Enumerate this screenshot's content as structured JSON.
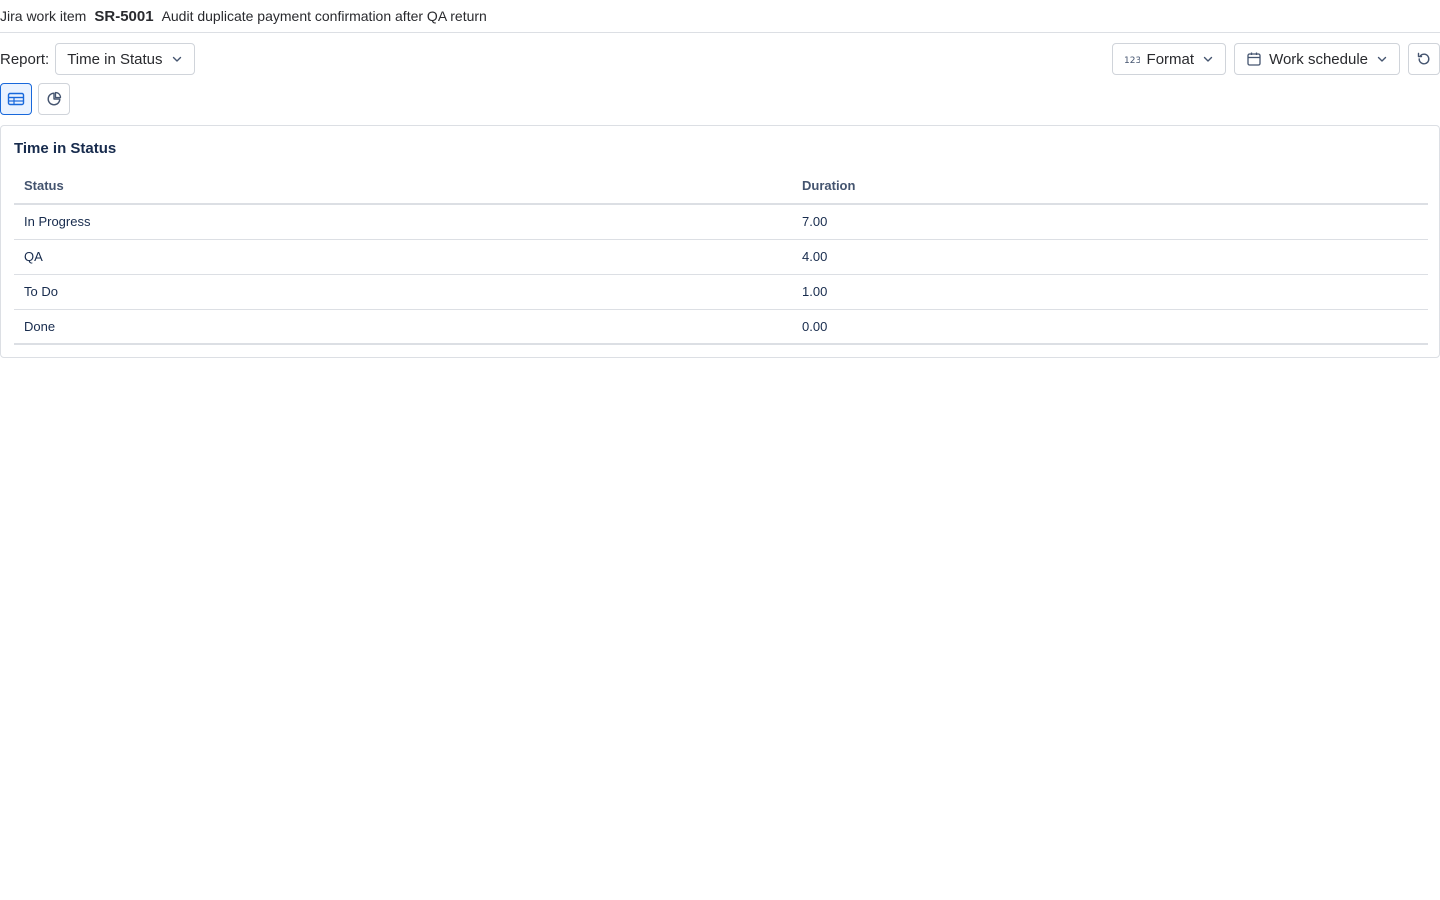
{
  "header": {
    "context_label": "Jira work item",
    "issue_key": "SR-5001",
    "issue_summary": "Audit duplicate payment confirmation after QA return"
  },
  "toolbar": {
    "report_label": "Report:",
    "report_selected": "Time in Status",
    "format_label": "Format",
    "work_schedule_label": "Work schedule"
  },
  "views": {
    "table_view_active": true,
    "chart_view_active": false
  },
  "card": {
    "title": "Time in Status",
    "columns": [
      "Status",
      "Duration"
    ],
    "rows": [
      {
        "status": "In Progress",
        "duration": "7.00"
      },
      {
        "status": "QA",
        "duration": "4.00"
      },
      {
        "status": "To Do",
        "duration": "1.00"
      },
      {
        "status": "Done",
        "duration": "0.00"
      }
    ]
  },
  "colors": {
    "accent": "#1868db",
    "active_bg": "#e9f2ff",
    "border": "#dcdfe4"
  },
  "icons": {
    "format": "numbers-123-icon",
    "work_schedule": "calendar-icon",
    "reset": "refresh-icon",
    "table_view": "table-icon",
    "chart_view": "pie-chart-icon",
    "dropdown": "chevron-down-icon"
  }
}
